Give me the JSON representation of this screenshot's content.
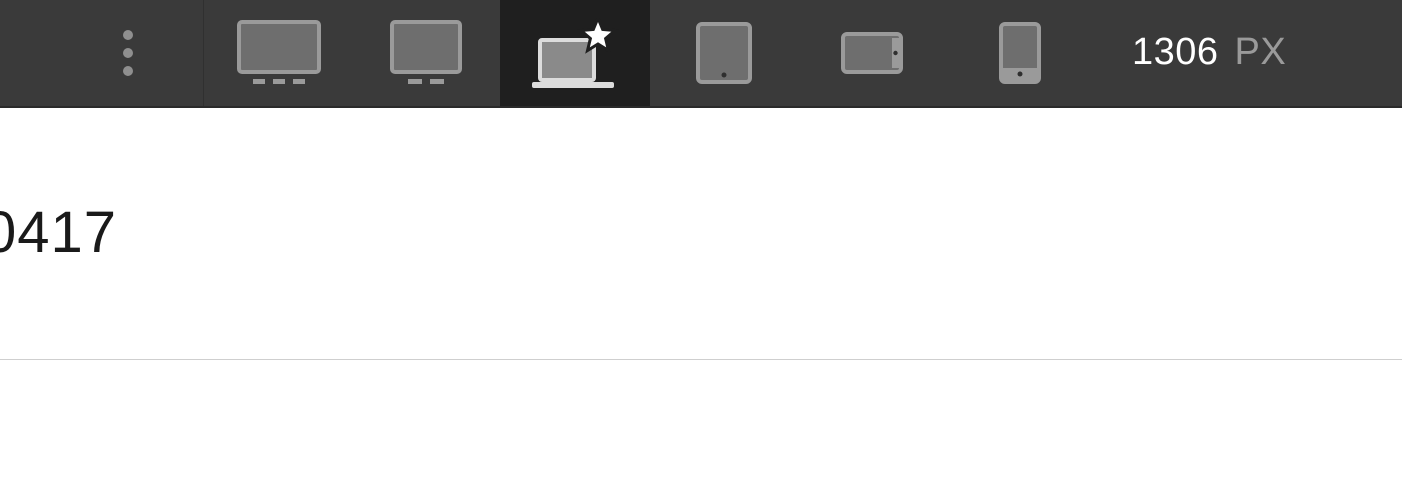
{
  "toolbar": {
    "more_icon": "vertical-ellipsis-icon",
    "devices": [
      {
        "name": "large-desktop",
        "icon": "large-desktop-monitor-icon",
        "active": false
      },
      {
        "name": "desktop",
        "icon": "desktop-monitor-icon",
        "active": false
      },
      {
        "name": "laptop-base",
        "icon": "laptop-star-icon",
        "active": true
      },
      {
        "name": "tablet-portrait",
        "icon": "tablet-portrait-icon",
        "active": false
      },
      {
        "name": "tablet-landscape",
        "icon": "tablet-landscape-icon",
        "active": false
      },
      {
        "name": "phone-portrait",
        "icon": "phone-portrait-icon",
        "active": false
      }
    ],
    "width_value": "1306",
    "width_unit": "PX"
  },
  "content": {
    "text": "0417"
  },
  "colors": {
    "toolbar_bg": "#3a3a3a",
    "active_bg": "#1f1f1f",
    "icon_gray": "#8a8a8a",
    "icon_active": "#dcdcdc"
  }
}
